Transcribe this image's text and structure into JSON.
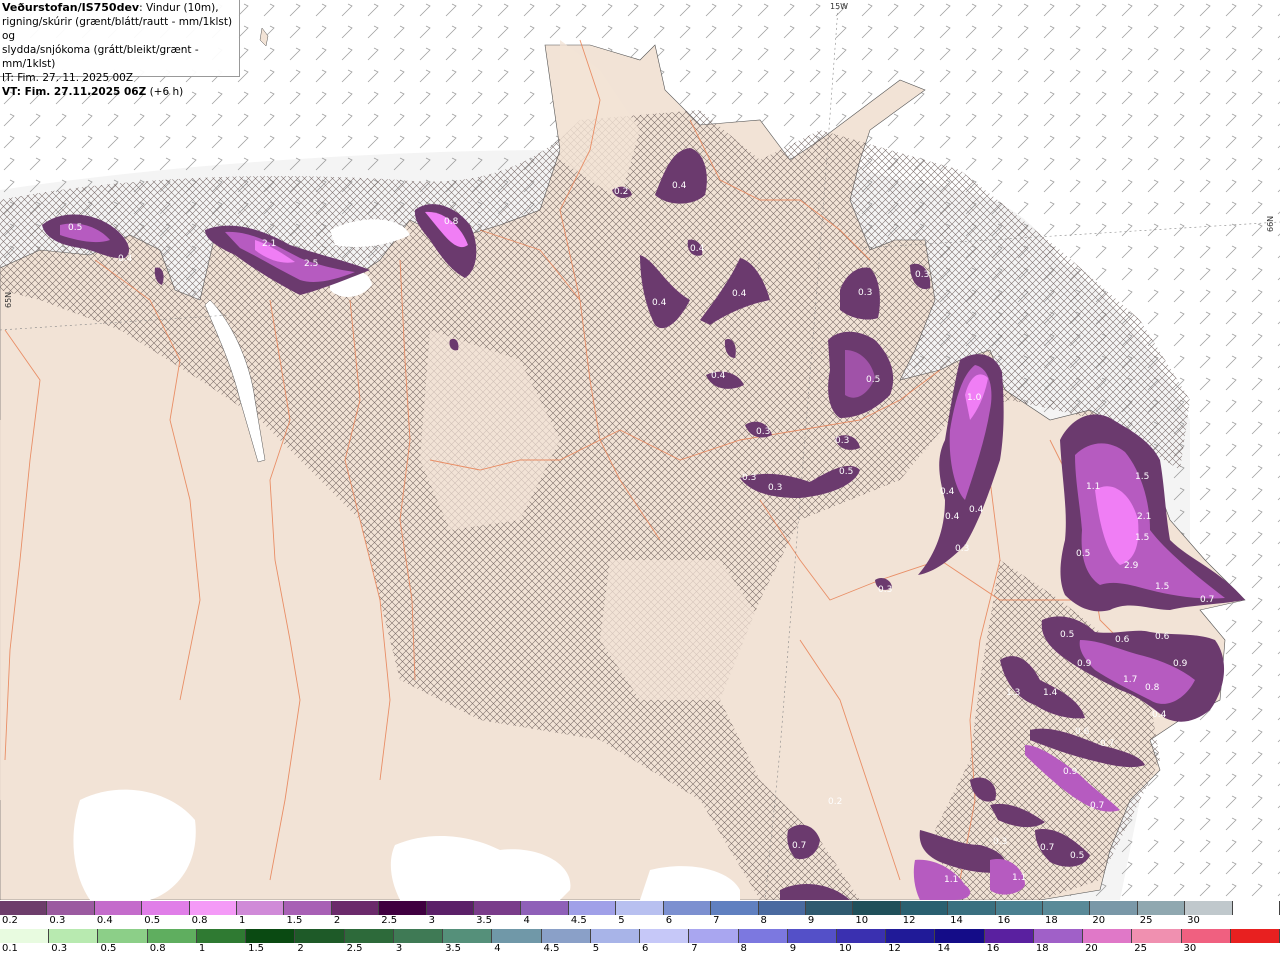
{
  "header": {
    "brand": "Veðurstofan/IS750dev",
    "line1_rest": ": Vindur (10m),",
    "line2": "rigning/skúrir (grænt/blátt/rautt - mm/1klst) og",
    "line3": "slydda/snjókoma (grátt/bleikt/grænt - mm/1klst)",
    "it": "IT: Fim. 27. 11. 2025 00Z",
    "vt_bold": "VT: Fim. 27.11.2025 06Z",
    "vt_rest": "(+6 h)"
  },
  "grid_labels": {
    "lon": "15W",
    "lat_left": "65N",
    "lat_right": "66N"
  },
  "colors": {
    "sea": "#ffffff",
    "land": "#f2e3d6",
    "roads": "#e8855a",
    "precip_light": "#6b3a6e",
    "precip_mid": "#b65bc0",
    "precip_heavy": "#f07ef5"
  },
  "precip_labels": [
    "0.5",
    "0.4",
    "2.1",
    "2.5",
    "0.8",
    "0.2",
    "0.4",
    "0.4",
    "0.4",
    "0.4",
    "0.3",
    "0.3",
    "0.5",
    "0.4",
    "0.3",
    "0.3",
    "0.5",
    "0.3",
    "0.3",
    "1.0",
    "0.4",
    "0.4",
    "0.4",
    "0.3",
    "0.3",
    "1.1",
    "1.5",
    "2.1",
    "1.5",
    "0.5",
    "2.9",
    "1.5",
    "0.7",
    "0.5",
    "0.6",
    "0.6",
    "0.9",
    "0.9",
    "1.7",
    "0.8",
    "1.3",
    "1.4",
    "0.4",
    "0.6",
    "0.7",
    "0.9",
    "0.7",
    "0.2",
    "0.3",
    "0.7",
    "0.5",
    "0.7",
    "1.1",
    "1.1"
  ],
  "legend_snow": {
    "labels": [
      "0.2",
      "0.3",
      "0.4",
      "0.5",
      "0.8",
      "1",
      "1.5",
      "2",
      "2.5",
      "3",
      "3.5",
      "4",
      "4.5",
      "5",
      "6",
      "7",
      "8",
      "9",
      "10",
      "12",
      "14",
      "16",
      "18",
      "20",
      "25",
      "30"
    ],
    "colors": [
      "#6d3d6b",
      "#9b5aa0",
      "#c46ccb",
      "#e07ee8",
      "#f49af7",
      "#d08ad8",
      "#a860b5",
      "#6b2a6b",
      "#400040",
      "#5b2068",
      "#7a3c8a",
      "#8f60b8",
      "#a0a0e8",
      "#b8c0f0",
      "#7c90d0",
      "#6080c0",
      "#4a6aa0",
      "#2f5a70",
      "#20505a",
      "#2a6070",
      "#3a7080",
      "#4a8090",
      "#5a8a98",
      "#7a98a8",
      "#90a8b0",
      "#c0c8cc",
      "#ffffff"
    ]
  },
  "legend_rain": {
    "labels": [
      "0.1",
      "0.3",
      "0.5",
      "0.8",
      "1",
      "1.5",
      "2",
      "2.5",
      "3",
      "3.5",
      "4",
      "4.5",
      "5",
      "6",
      "7",
      "8",
      "9",
      "10",
      "12",
      "14",
      "16",
      "18",
      "20",
      "25",
      "30"
    ],
    "colors": [
      "#e8fbe0",
      "#b8eab0",
      "#8ccf88",
      "#5fae5f",
      "#2f7a32",
      "#0a4a12",
      "#1e5a28",
      "#2d6a3a",
      "#3f7a55",
      "#55907a",
      "#7098a8",
      "#8aa0c8",
      "#a8b4e8",
      "#c6c8f8",
      "#a9a6f0",
      "#7c78e0",
      "#5450c8",
      "#3a30b0",
      "#201a98",
      "#140c88",
      "#5a20a0",
      "#a060c8",
      "#e078c8",
      "#f090b0",
      "#f06080",
      "#e82020"
    ]
  }
}
